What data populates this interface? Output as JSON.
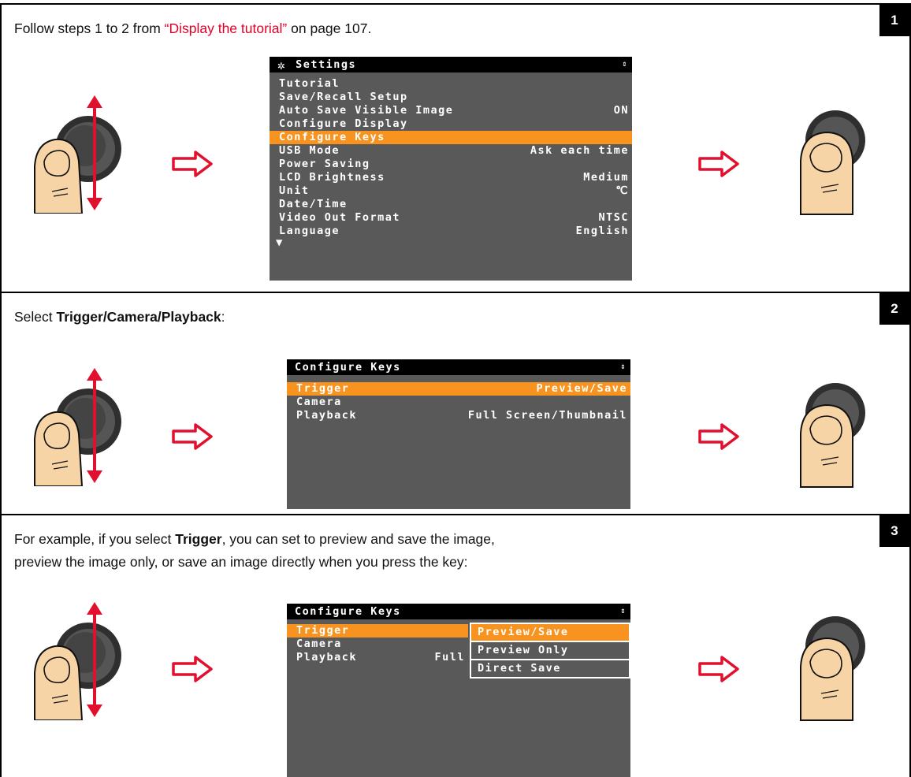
{
  "steps": [
    {
      "number": "1",
      "text_before": "Follow steps 1 to 2 from ",
      "link": "“Display the tutorial”",
      "text_after": " on page 107."
    },
    {
      "number": "2",
      "text_before": "Select ",
      "bold": "Trigger/Camera/Playback",
      "text_after": ":"
    },
    {
      "number": "3",
      "line1_before": "For example, if you select ",
      "line1_bold": "Trigger",
      "line1_after": ", you can set to preview and save the image,",
      "line2": "preview the image only, or save an image directly when you press the key:"
    }
  ],
  "settings_screen": {
    "title": "Settings",
    "rows": [
      {
        "label": "Tutorial",
        "value": ""
      },
      {
        "label": "Save/Recall Setup",
        "value": ""
      },
      {
        "label": "Auto Save Visible Image",
        "value": "ON"
      },
      {
        "label": "Configure Display",
        "value": ""
      },
      {
        "label": "Configure Keys",
        "value": ""
      },
      {
        "label": "USB Mode",
        "value": "Ask each time"
      },
      {
        "label": "Power Saving",
        "value": ""
      },
      {
        "label": "LCD Brightness",
        "value": "Medium"
      },
      {
        "label": "Unit",
        "value": "℃"
      },
      {
        "label": "Date/Time",
        "value": ""
      },
      {
        "label": "Video Out Format",
        "value": "NTSC"
      },
      {
        "label": "Language",
        "value": "English"
      }
    ],
    "selected_index": 4,
    "more_indicator": "▼"
  },
  "keys_screen": {
    "title": "Configure Keys",
    "rows": [
      {
        "label": "Trigger",
        "value": "Preview/Save"
      },
      {
        "label": "Camera",
        "value": ""
      },
      {
        "label": "Playback",
        "value": "Full Screen/Thumbnail"
      }
    ],
    "selected_index": 0
  },
  "keys_popup_screen": {
    "title": "Configure Keys",
    "rows": [
      {
        "label": "Trigger",
        "value": ""
      },
      {
        "label": "Camera",
        "value": ""
      },
      {
        "label": "Playback",
        "value": "Full"
      }
    ],
    "options": [
      "Preview/Save",
      "Preview Only",
      "Direct Save"
    ],
    "selected_option": 0
  },
  "colors": {
    "link": "#e0002a",
    "highlight": "#f7931e",
    "screen_bg": "#595959",
    "nav_arrow": "#e0102e"
  }
}
